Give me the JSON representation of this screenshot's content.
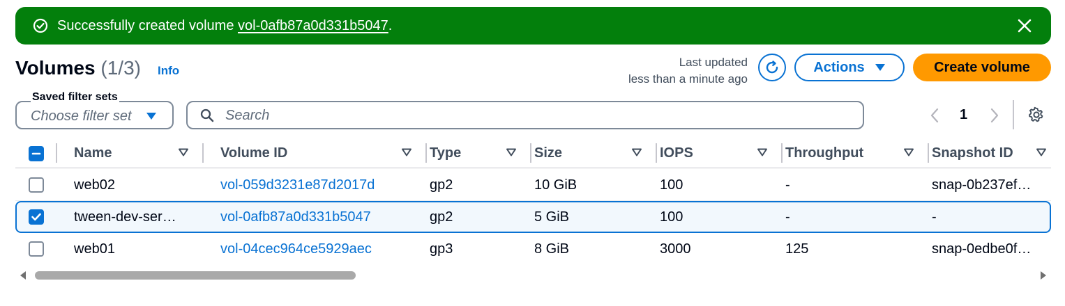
{
  "flash": {
    "message_prefix": "Successfully created volume ",
    "volume_link": "vol-0afb87a0d331b5047",
    "message_suffix": ".",
    "color": "#037f0c"
  },
  "header": {
    "title": "Volumes",
    "count": "(1/3)",
    "info_label": "Info",
    "last_updated_line1": "Last updated",
    "last_updated_line2": "less than a minute ago",
    "actions_label": "Actions",
    "create_label": "Create volume",
    "accent_color": "#0972d3",
    "primary_color": "#ff9900"
  },
  "filters": {
    "saved_label": "Saved filter sets",
    "saved_placeholder": "Choose filter set",
    "search_placeholder": "Search"
  },
  "pagination": {
    "current_page": "1"
  },
  "table": {
    "columns": [
      "Name",
      "Volume ID",
      "Type",
      "Size",
      "IOPS",
      "Throughput",
      "Snapshot ID"
    ],
    "rows": [
      {
        "selected": false,
        "name": "web02",
        "volume_id": "vol-059d3231e87d2017d",
        "type": "gp2",
        "size": "10 GiB",
        "iops": "100",
        "throughput": "-",
        "snapshot_id": "snap-0b237ef…"
      },
      {
        "selected": true,
        "name": "tween-dev-ser…",
        "volume_id": "vol-0afb87a0d331b5047",
        "type": "gp2",
        "size": "5 GiB",
        "iops": "100",
        "throughput": "-",
        "snapshot_id": "-"
      },
      {
        "selected": false,
        "name": "web01",
        "volume_id": "vol-04cec964ce5929aec",
        "type": "gp3",
        "size": "8 GiB",
        "iops": "3000",
        "throughput": "125",
        "snapshot_id": "snap-0edbe0f…"
      }
    ]
  }
}
